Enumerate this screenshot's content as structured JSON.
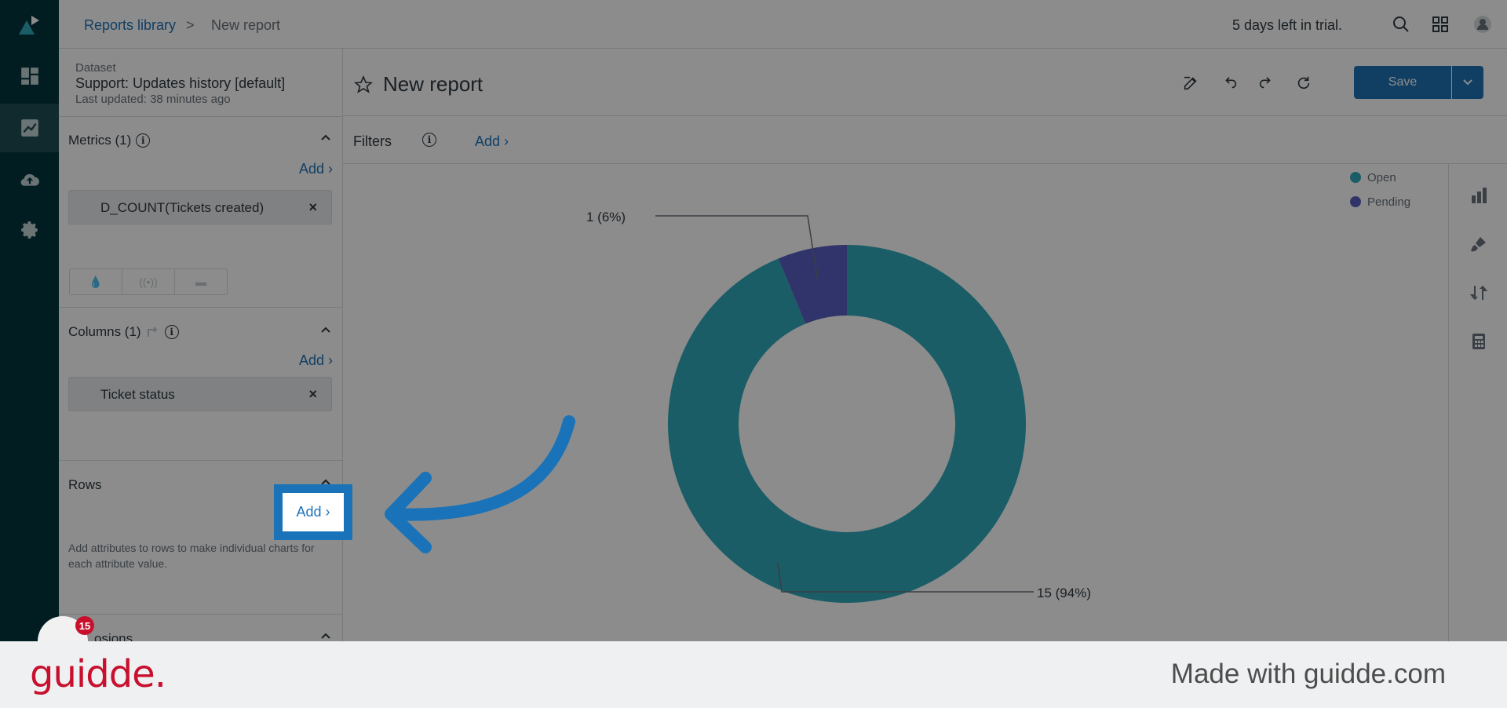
{
  "breadcrumb": {
    "library": "Reports library",
    "separator": ">",
    "current": "New report"
  },
  "topbar": {
    "trial": "5 days left in trial."
  },
  "dataset": {
    "label": "Dataset",
    "name": "Support: Updates history [default]",
    "updated": "Last updated: 38 minutes ago"
  },
  "metrics": {
    "title": "Metrics (1)",
    "add": "Add ›",
    "item": "D_COUNT(Tickets created)",
    "remove": "×"
  },
  "columns": {
    "title": "Columns (1)",
    "add": "Add ›",
    "item": "Ticket status",
    "remove": "×"
  },
  "rows": {
    "title": "Rows",
    "add": "Add ›",
    "hint": "Add attributes to rows to make individual charts for each attribute value."
  },
  "explosions": {
    "title_partial": "osions"
  },
  "report": {
    "title": "New report",
    "save": "Save"
  },
  "filters": {
    "label": "Filters",
    "add": "Add ›"
  },
  "badge": {
    "count": "15"
  },
  "footer": {
    "brand": "guidde.",
    "made_with": "Made with guidde.com"
  },
  "colors": {
    "open": "#30aabc",
    "pending": "#5a5fc2",
    "accent": "#1f73b7",
    "nav": "#03363d"
  },
  "chart_data": {
    "type": "pie",
    "variant": "donut",
    "categories": [
      "Open",
      "Pending"
    ],
    "values": [
      15,
      1
    ],
    "data_labels": [
      "15 (94%)",
      "1 (6%)"
    ],
    "legend": [
      "Open",
      "Pending"
    ],
    "legend_position": "top-right"
  }
}
